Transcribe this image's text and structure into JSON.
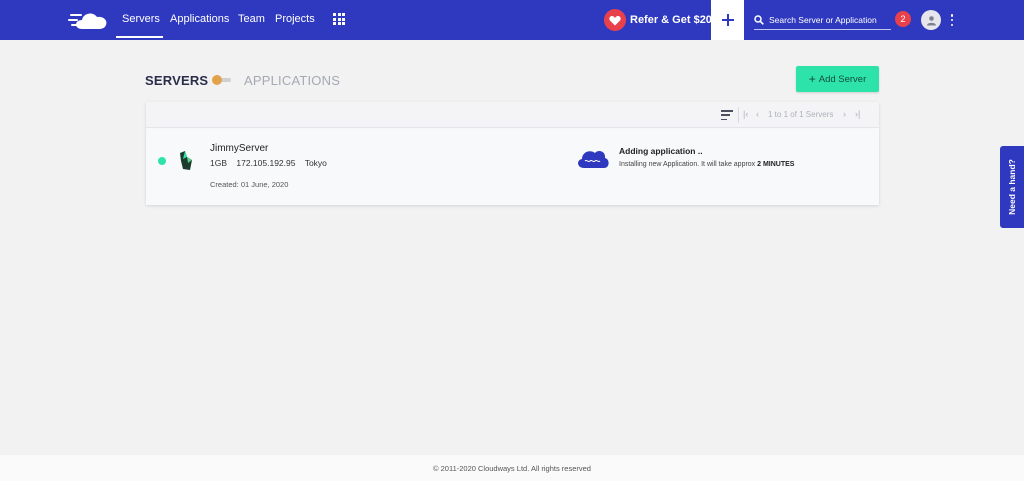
{
  "nav": {
    "items": [
      {
        "label": "Servers",
        "active": true
      },
      {
        "label": "Applications"
      },
      {
        "label": "Team"
      },
      {
        "label": "Projects"
      }
    ],
    "refer_label": "Refer & Get $20",
    "search_placeholder": "Search Server or Application",
    "notification_count": "2",
    "icons": [
      "cloudways-logo-icon",
      "apps-grid-icon",
      "heart-icon",
      "plus-icon",
      "search-icon",
      "user-icon",
      "kebab-menu-icon"
    ]
  },
  "page": {
    "servers_heading": "SERVERS",
    "applications_heading": "APPLICATIONS",
    "add_server_label": "Add Server"
  },
  "list": {
    "pagination_text": "1 to 1 of 1 Servers",
    "servers": [
      {
        "name": "JimmyServer",
        "size": "1GB",
        "ip": "172.105.192.95",
        "location": "Tokyo",
        "created": "Created: 01 June, 2020",
        "status_color": "#2ee3a9",
        "activity_title": "Adding application ..",
        "activity_desc": "Installing new Application. It will take approx",
        "activity_eta": "2 MINUTES"
      }
    ]
  },
  "help_label": "Need a hand?",
  "footer_text": "© 2011-2020 Cloudways Ltd. All rights reserved",
  "colors": {
    "brand": "#2f39bf",
    "accent": "#2ee3a9",
    "alert": "#e8414b"
  }
}
